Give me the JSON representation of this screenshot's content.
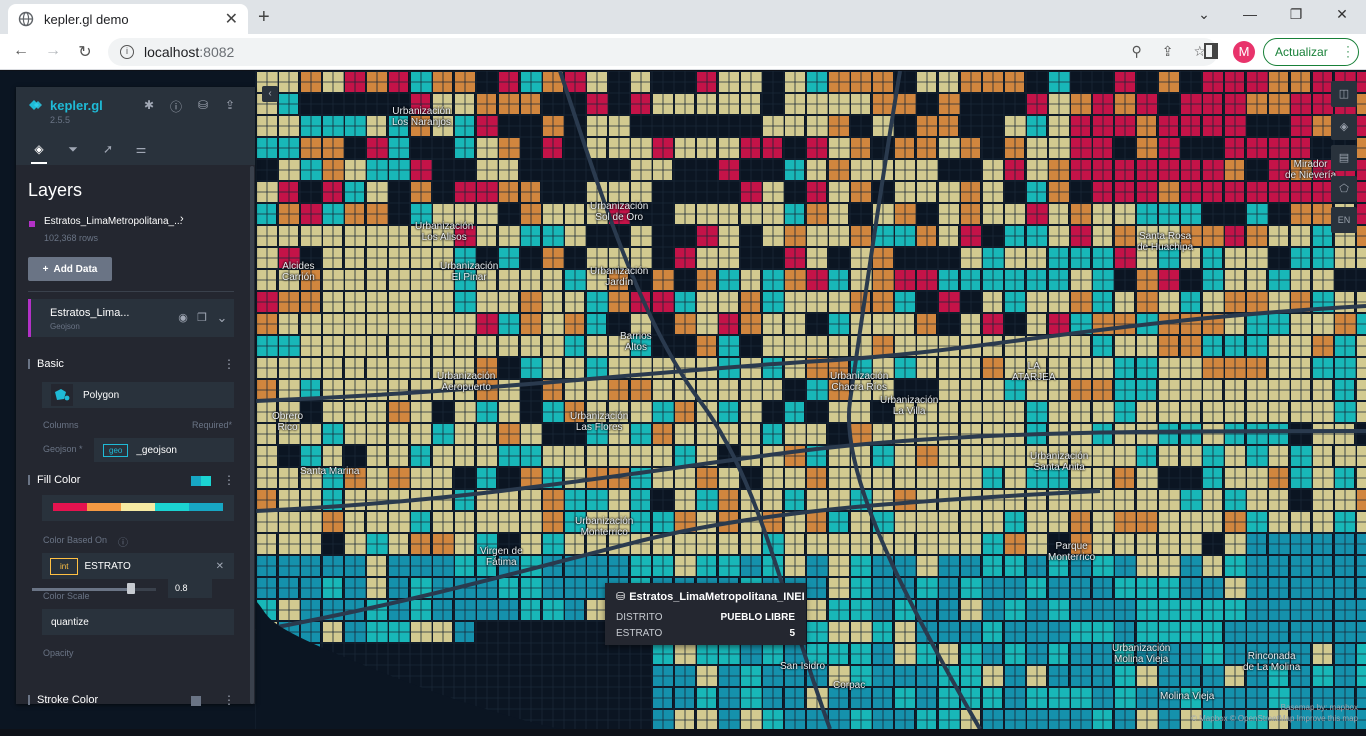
{
  "browser": {
    "tab_title": "kepler.gl demo",
    "url_host": "localhost",
    "url_port": ":8082",
    "update_button": "Actualizar",
    "profile_initial": "M"
  },
  "panel": {
    "brand": "kepler.gl",
    "version": "2.5.5",
    "section_title": "Layers",
    "dataset": {
      "name": "Estratos_LimaMetropolitana_...",
      "rows": "102,368 rows",
      "color": "#b331c7"
    },
    "add_data_label": "Add Data",
    "layer": {
      "name": "Estratos_Lima...",
      "type": "Geojson"
    },
    "basic_label": "Basic",
    "layer_type_value": "Polygon",
    "columns_label": "Columns",
    "required_label": "Required*",
    "geojson_label": "Geojson *",
    "geo_pill": "geo",
    "geojson_value": "_geojson",
    "fill_color_label": "Fill Color",
    "palette": [
      "#e5134f",
      "#f49a43",
      "#f6eaa3",
      "#1bd4d2",
      "#17a7c4"
    ],
    "color_based_on_label": "Color Based On",
    "int_pill": "int",
    "color_field_value": "ESTRATO",
    "color_scale_label": "Color Scale",
    "color_scale_value": "quantize",
    "opacity_label": "Opacity",
    "opacity_value": "0.8",
    "stroke_color_label": "Stroke Color"
  },
  "tooltip": {
    "title": "Estratos_LimaMetropolitana_INEI",
    "rows": [
      {
        "key": "DISTRITO",
        "value": "PUEBLO LIBRE"
      },
      {
        "key": "ESTRATO",
        "value": "5"
      }
    ]
  },
  "map": {
    "controls": [
      "split-map",
      "layers",
      "table",
      "draw",
      "EN"
    ],
    "labels": [
      "Urbanización\nLos Naranjos",
      "Urbanización\nSol de Oro",
      "Urbanización\nLos Alisos",
      "Urbanización\nEl Pinar",
      "Santa Rosa\nde Huachipa",
      "Mirador\nde Nievería",
      "LA\nATARJEA",
      "Urbanización\nChacra Ríos",
      "Urbanización\nLas Flores",
      "Virgen de\nFátima",
      "Urbanización\nMonterrico",
      "Parque\nMonterrico",
      "San Isidro",
      "Corpac",
      "Molina Vieja",
      "Urbanización\nMolina Vieja",
      "Rinconada\nde La Molina",
      "Alcides\nCarrión",
      "Obrero\nRico",
      "Santa Marina",
      "Urbanización\nAeropuerto",
      "Urbanización\nJardín",
      "Urbanización\nLa Villa",
      "Barrios\nAltos",
      "Urbanización\nSanta Anita"
    ],
    "attribution_line1": "Basemap by: mapbox",
    "attribution_line2": "© Mapbox © OpenStreetMap Improve this map"
  }
}
